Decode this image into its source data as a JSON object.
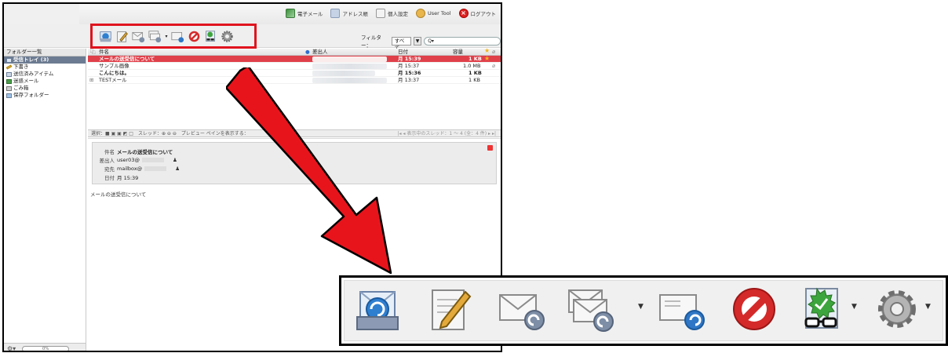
{
  "top_links": {
    "email": "電子メール",
    "address_book": "アドレス帳",
    "personal_settings": "個人設定",
    "user_tool": "User Tool",
    "logout": "ログアウト"
  },
  "filter": {
    "label": "フィルター：",
    "value": "すべて",
    "dropdown_glyph": "▼",
    "search_placeholder": "Q▾"
  },
  "folders": {
    "title": "フォルダー一覧",
    "items": [
      {
        "label": "受信トレイ (3)",
        "icon": "inbox-icon",
        "selected": true
      },
      {
        "label": "下書き",
        "icon": "pencil-icon"
      },
      {
        "label": "送信済みアイテム",
        "icon": "sent-icon"
      },
      {
        "label": "迷惑メール",
        "icon": "junk-icon"
      },
      {
        "label": "ごみ箱",
        "icon": "trash-icon"
      },
      {
        "label": "保存フォルダー",
        "icon": "folder-icon"
      }
    ],
    "quota": "0%",
    "gear": "⚙▾"
  },
  "list": {
    "headers": {
      "subject": "件名",
      "sender": "差出人",
      "date": "日付",
      "size": "容量"
    },
    "rows": [
      {
        "subject": "メールの送受信について",
        "date": "月 15:39",
        "size": "1 KB"
      },
      {
        "subject": "サンプル画像",
        "date": "月 15:37",
        "size": "1.0 MB"
      },
      {
        "subject": "こんにちは。",
        "date": "月 15:36",
        "size": "1 KB"
      },
      {
        "subject": "TESTメール",
        "date": "月 13:37",
        "size": "1 KB"
      }
    ],
    "footer_left": "選択：■ ▣ ▣ ◩ □　スレッド：⊕ ⊖ ⊖　プレビュー ペインを表示する：",
    "footer_right": "|◂ ◂ 表示中のスレッド：1 ～ 4 (全：4 件) ▸ ▸|"
  },
  "preview": {
    "subject_label": "件名",
    "subject": "メールの送受信について",
    "from_label": "差出人",
    "from": "user03@",
    "to_label": "宛先",
    "to": "mailbox@",
    "date_label": "日付",
    "date": "月 15:39",
    "body": "メールの送受信について"
  },
  "toolbar": {
    "icons": [
      "receive-mail-icon",
      "compose-icon",
      "reply-icon",
      "reply-all-icon",
      "forward-icon",
      "delete-icon",
      "mark-junk-icon",
      "settings-icon"
    ]
  },
  "colors": {
    "highlight_red": "#e0141e",
    "selected_row": "#e0404a",
    "arrow_red": "#e8141c"
  }
}
